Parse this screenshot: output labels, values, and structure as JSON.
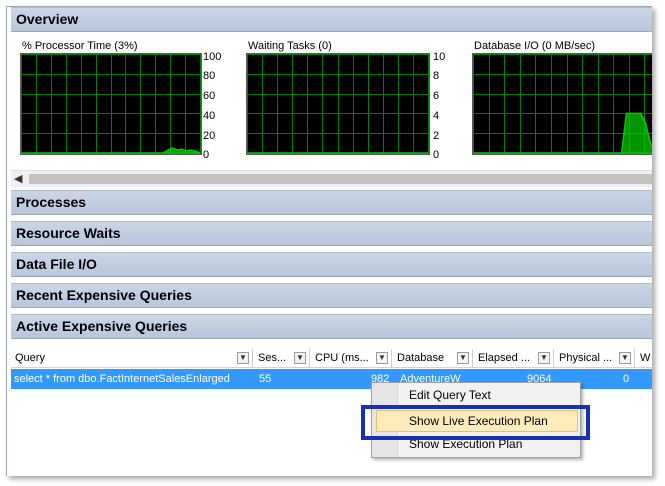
{
  "sections": {
    "overview": "Overview",
    "processes": "Processes",
    "resource_waits": "Resource Waits",
    "data_file_io": "Data File I/O",
    "recent_expensive": "Recent Expensive Queries",
    "active_expensive": "Active Expensive Queries"
  },
  "charts": [
    {
      "title": "% Processor Time (3%)",
      "ticks": [
        "100",
        "80",
        "60",
        "40",
        "20",
        "0"
      ]
    },
    {
      "title": "Waiting Tasks (0)",
      "ticks": [
        "10",
        "8",
        "6",
        "4",
        "2",
        "0"
      ]
    },
    {
      "title": "Database I/O (0 MB/sec)",
      "ticks": []
    }
  ],
  "chart_data": [
    {
      "type": "area",
      "title": "% Processor Time (3%)",
      "ylim": [
        0,
        100
      ],
      "series": [
        {
          "values": [
            0,
            0,
            0,
            0,
            0,
            0,
            0,
            0,
            0,
            0,
            0,
            0,
            0,
            0,
            0,
            0,
            0,
            0,
            0,
            0,
            0,
            0,
            0,
            0,
            0,
            0,
            0,
            0,
            0,
            0,
            0,
            0,
            3,
            5,
            3,
            4,
            2,
            3,
            2,
            0
          ]
        }
      ],
      "grid": true,
      "line_color": "#00c800"
    },
    {
      "type": "area",
      "title": "Waiting Tasks (0)",
      "ylim": [
        0,
        10
      ],
      "series": [
        {
          "values": [
            0,
            0,
            0,
            0,
            0,
            0,
            0,
            0,
            0,
            0,
            0,
            0,
            0,
            0,
            0,
            0,
            0,
            0,
            0,
            0,
            0,
            0,
            0,
            0,
            0,
            0,
            0,
            0,
            0,
            0,
            0,
            0,
            0,
            0,
            0,
            0,
            0,
            0,
            0,
            0
          ]
        }
      ],
      "grid": true,
      "line_color": "#00c800"
    },
    {
      "type": "area",
      "title": "Database I/O (0 MB/sec)",
      "ylim": [
        0,
        10
      ],
      "series": [
        {
          "values": [
            0,
            0,
            0,
            0,
            0,
            0,
            0,
            0,
            0,
            0,
            0,
            0,
            0,
            0,
            0,
            0,
            0,
            0,
            0,
            0,
            0,
            0,
            0,
            0,
            0,
            0,
            0,
            0,
            0,
            0,
            0,
            0,
            4,
            4,
            4,
            4,
            3,
            1,
            0,
            0
          ]
        }
      ],
      "grid": true,
      "line_color": "#00c800"
    }
  ],
  "grid": {
    "columns": [
      "Query",
      "Ses...",
      "CPU (ms...",
      "Database",
      "Elapsed ...",
      "Physical ...",
      "W"
    ],
    "rows": [
      {
        "query": "select * from dbo.FactInternetSalesEnlarged",
        "session": "55",
        "cpu": "982",
        "database": "AdventureW",
        "elapsed": "9064",
        "physical": "0"
      }
    ]
  },
  "context_menu": {
    "items": [
      "Edit Query Text",
      "Show Live Execution Plan",
      "Show Execution Plan"
    ]
  },
  "colors": {
    "header_bg": "#b8c7dc",
    "selection": "#3399ff",
    "callout": "#1b2fb5",
    "chart_line": "#00c800"
  }
}
